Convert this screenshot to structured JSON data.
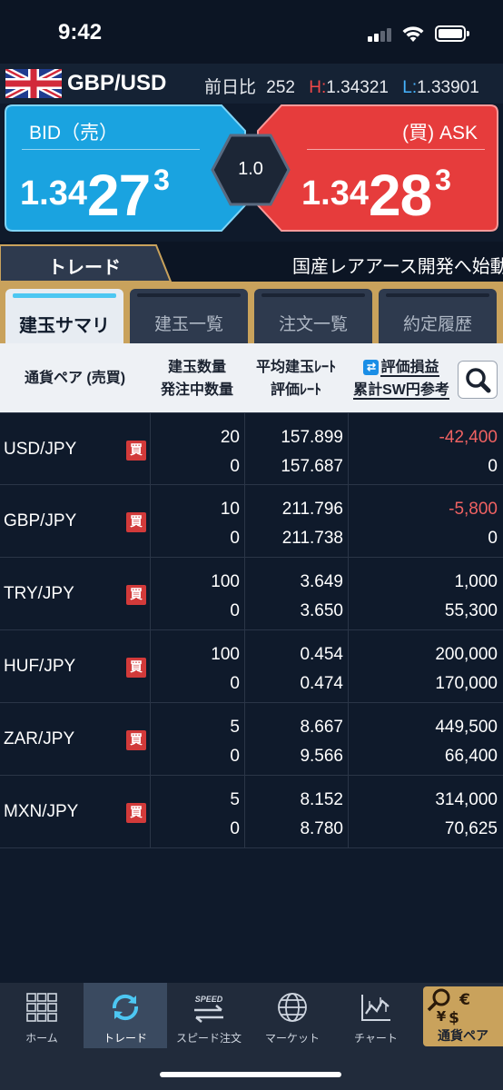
{
  "status_bar": {
    "time": "9:42"
  },
  "pair_header": {
    "flag": "uk-flag",
    "pair": "GBP/USD",
    "change_label": "前日比",
    "change_value": "252",
    "high_label": "H:",
    "high_value": "1.34321",
    "low_label": "L:",
    "low_value": "1.33901"
  },
  "quotes": {
    "bid": {
      "label": "BID（売）",
      "price_main": "1.34",
      "price_big": "27",
      "price_pip": "3",
      "color": "#1aa3e0"
    },
    "ask": {
      "label": "(買) ASK",
      "price_main": "1.34",
      "price_big": "28",
      "price_pip": "3",
      "color": "#e63c3c"
    },
    "spread": "1.0"
  },
  "trade_tab": {
    "label": "トレード"
  },
  "ticker": {
    "text": "国産レアアース開発へ始動"
  },
  "sub_tabs": [
    {
      "label": "建玉サマリ",
      "active": true
    },
    {
      "label": "建玉一覧",
      "active": false
    },
    {
      "label": "注文一覧",
      "active": false
    },
    {
      "label": "約定履歴",
      "active": false
    }
  ],
  "table": {
    "headers": {
      "pair": "通貨ペア (売買)",
      "qty_1": "建玉数量",
      "qty_2": "発注中数量",
      "rate_1": "平均建玉ﾚｰﾄ",
      "rate_2": "評価ﾚｰﾄ",
      "pl_toggle_icon": "⇄",
      "pl_1": "評価損益",
      "pl_2": "累計SW円参考"
    },
    "rows": [
      {
        "pair": "USD/JPY",
        "side": "買",
        "qty": "20",
        "pending": "0",
        "avg_rate": "157.899",
        "eval_rate": "157.687",
        "pl": "-42,400",
        "swap": "0"
      },
      {
        "pair": "GBP/JPY",
        "side": "買",
        "qty": "10",
        "pending": "0",
        "avg_rate": "211.796",
        "eval_rate": "211.738",
        "pl": "-5,800",
        "swap": "0"
      },
      {
        "pair": "TRY/JPY",
        "side": "買",
        "qty": "100",
        "pending": "0",
        "avg_rate": "3.649",
        "eval_rate": "3.650",
        "pl": "1,000",
        "swap": "55,300"
      },
      {
        "pair": "HUF/JPY",
        "side": "買",
        "qty": "100",
        "pending": "0",
        "avg_rate": "0.454",
        "eval_rate": "0.474",
        "pl": "200,000",
        "swap": "170,000"
      },
      {
        "pair": "ZAR/JPY",
        "side": "買",
        "qty": "5",
        "pending": "0",
        "avg_rate": "8.667",
        "eval_rate": "9.566",
        "pl": "449,500",
        "swap": "66,400"
      },
      {
        "pair": "MXN/JPY",
        "side": "買",
        "qty": "5",
        "pending": "0",
        "avg_rate": "8.152",
        "eval_rate": "8.780",
        "pl": "314,000",
        "swap": "70,625"
      }
    ]
  },
  "bottom_nav": {
    "items": [
      {
        "label": "ホーム",
        "icon": "grid-icon"
      },
      {
        "label": "トレード",
        "icon": "refresh-arrows-icon",
        "active": true
      },
      {
        "label": "スピード注文",
        "icon": "speed-arrows-icon",
        "badge": "SPEED"
      },
      {
        "label": "マーケット",
        "icon": "globe-icon"
      },
      {
        "label": "チャート",
        "icon": "chart-icon"
      }
    ],
    "pair_button": {
      "label": "通貨ペア",
      "icon": "currency-search-icon",
      "glyph_euro": "€",
      "glyph_yen": "¥",
      "glyph_dollar": "$"
    }
  }
}
